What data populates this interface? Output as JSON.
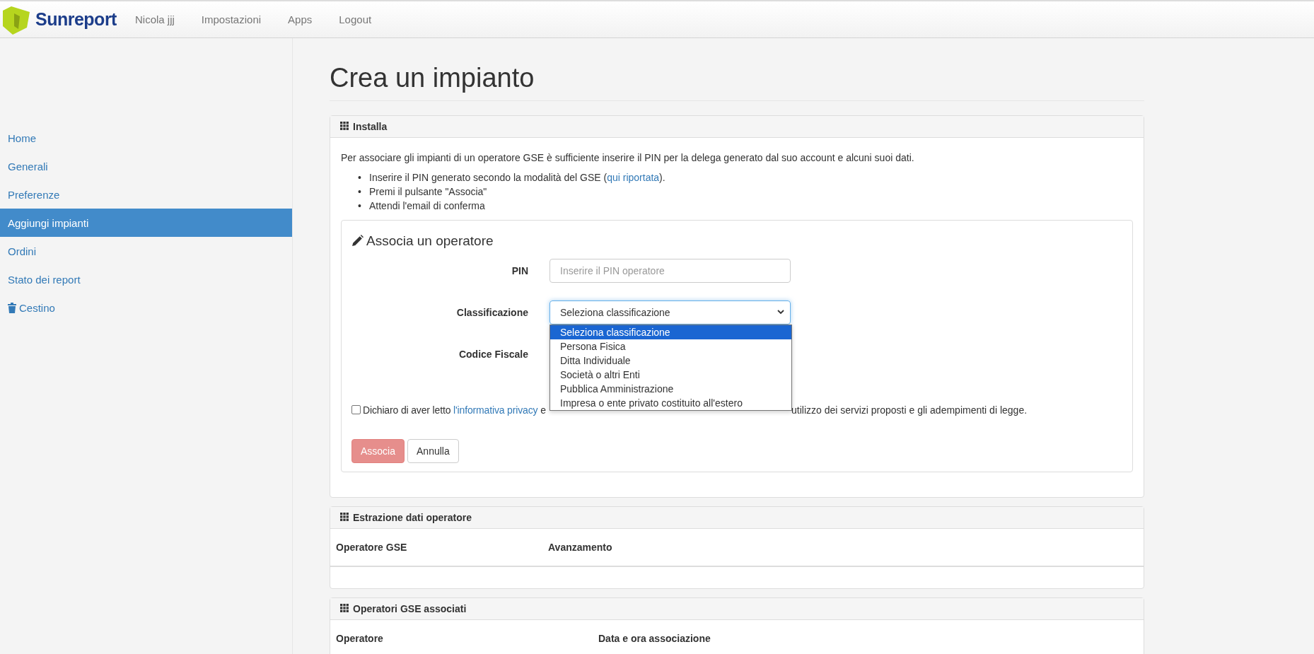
{
  "navbar": {
    "brand": "Sunreport",
    "links": [
      "Nicola jjj",
      "Impostazioni",
      "Apps",
      "Logout"
    ]
  },
  "sidebar": {
    "items": [
      {
        "label": "Home",
        "selected": false,
        "kind": "plain"
      },
      {
        "label": "Generali",
        "selected": false,
        "kind": "plain"
      },
      {
        "label": "Preferenze",
        "selected": false,
        "kind": "plain"
      },
      {
        "label": "Aggiungi impianti",
        "selected": true,
        "kind": "plain"
      },
      {
        "label": "Ordini",
        "selected": false,
        "kind": "plain"
      },
      {
        "label": "Stato dei report",
        "selected": false,
        "kind": "plain"
      },
      {
        "label": "Cestino",
        "selected": false,
        "kind": "trash"
      }
    ]
  },
  "page_title": "Crea un impianto",
  "install_panel": {
    "title": "Installa",
    "intro": "Per associare gli impianti di un operatore GSE è sufficiente inserire il PIN per la delega generato dal suo account e alcuni suoi dati.",
    "steps": [
      {
        "marker": "•",
        "text": "Inserire il PIN generato secondo la modalità del GSE (",
        "link": "qui riportata",
        "after": ")."
      },
      {
        "marker": "•",
        "text": "Premi il pulsante \"Associa\""
      },
      {
        "marker": "•",
        "text": "Attendi l'email di conferma"
      }
    ],
    "form": {
      "title": "Associa un operatore",
      "pin": {
        "label": "PIN",
        "placeholder": "Inserire il PIN operatore"
      },
      "classification": {
        "label": "Classificazione",
        "value": "Seleziona classificazione",
        "expanded": true,
        "options": [
          {
            "label": "Seleziona classificazione",
            "selected": true
          },
          {
            "label": "Persona Fisica",
            "selected": false
          },
          {
            "label": "Ditta Individuale",
            "selected": false
          },
          {
            "label": "Società o altri Enti",
            "selected": false
          },
          {
            "label": "Pubblica Amministrazione",
            "selected": false
          },
          {
            "label": "Impresa o ente privato costituito all'estero",
            "selected": false
          }
        ]
      },
      "tax_code": {
        "label": "Codice Fiscale"
      },
      "consent": {
        "checked": false,
        "before": "Dichiaro di aver letto ",
        "link": "l'informativa privacy",
        "after": " e",
        "tail": "utilizzo dei servizi proposti e gli adempimenti di legge."
      },
      "buttons": [
        {
          "label": "Associa",
          "kind": "primary",
          "disabled": true
        },
        {
          "label": "Annulla",
          "kind": "default",
          "disabled": false
        }
      ]
    }
  },
  "extraction_panel": {
    "title": "Estrazione dati operatore",
    "columns": [
      "Operatore GSE",
      "Avanzamento"
    ]
  },
  "associated_panel": {
    "title": "Operatori GSE associati",
    "columns": [
      "Operatore",
      "Data e ora associazione"
    ]
  }
}
